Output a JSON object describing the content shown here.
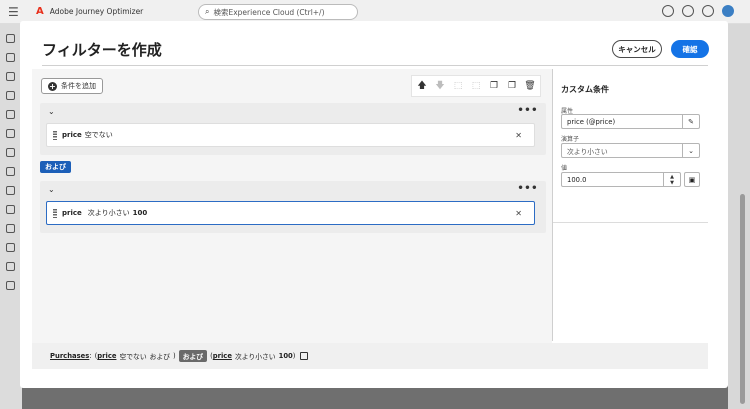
{
  "app": {
    "name": "Adobe Journey Optimizer",
    "search_placeholder": "検索Experience Cloud (Ctrl+/)"
  },
  "modal": {
    "title": "フィルターを作成",
    "cancel_label": "キャンセル",
    "confirm_label": "確認"
  },
  "toolbar": {
    "add_condition_label": "条件を追加"
  },
  "groups": [
    {
      "conditions": [
        {
          "attribute": "price",
          "operator": "空でない",
          "value": ""
        }
      ]
    },
    {
      "conditions": [
        {
          "attribute": "price",
          "operator": "次より小さい",
          "value": "100"
        }
      ]
    }
  ],
  "connector": "および",
  "panel": {
    "title": "カスタム条件",
    "attribute_label": "属性",
    "attribute_value": "price (@price)",
    "operator_label": "演算子",
    "operator_value": "次より小さい",
    "value_label": "値",
    "value_value": "100.0"
  },
  "summary": {
    "collection": "Purchases",
    "colon": ":",
    "open1": "(",
    "attr1": "price",
    "op1": "空でない",
    "and_word": "および",
    "close1": ")",
    "pill": "および",
    "open2": "(",
    "attr2": "price",
    "op2": "次より小さい",
    "val2": "100",
    "close2": ")"
  },
  "colors": {
    "accent": "#1473e6",
    "connector": "#1c5fb8"
  }
}
